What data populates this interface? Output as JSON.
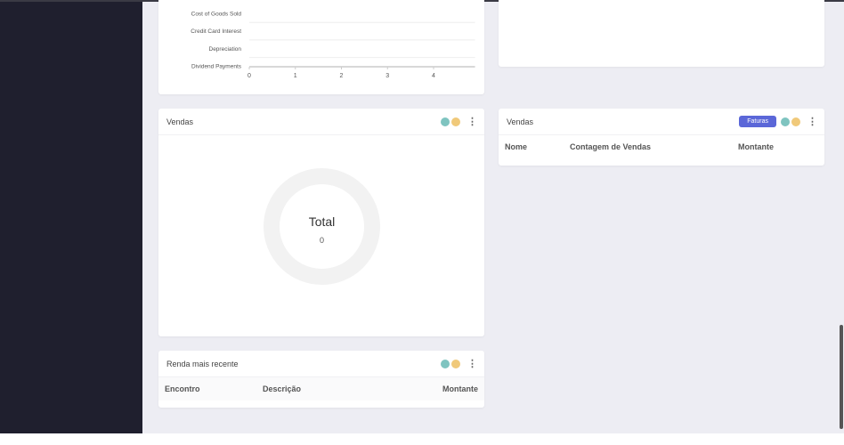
{
  "chart_data": {
    "type": "bar",
    "orientation": "horizontal",
    "categories": [
      "Cost of Goods Sold",
      "Credit Card Interest",
      "Depreciation",
      "Dividend Payments"
    ],
    "values": [
      0,
      0,
      0,
      0
    ],
    "xticks": [
      "0",
      "1",
      "2",
      "3",
      "4"
    ],
    "xlim": [
      0,
      4.9
    ],
    "grid": true
  },
  "vendas_donut": {
    "title": "Vendas",
    "center_label": "Total",
    "center_value": "0"
  },
  "renda": {
    "title": "Renda mais recente",
    "columns": [
      "Encontro",
      "Descrição",
      "Montante"
    ]
  },
  "vendas_table": {
    "title": "Vendas",
    "button": "Faturas",
    "columns": [
      "Nome",
      "Contagem de Vendas",
      "Montante"
    ]
  },
  "colors": {
    "sidebar": "#1f1f2e",
    "background": "#ededf3",
    "accent": "#5b67d8",
    "teal": "#7fc4c0",
    "yellow": "#f0c97a"
  }
}
